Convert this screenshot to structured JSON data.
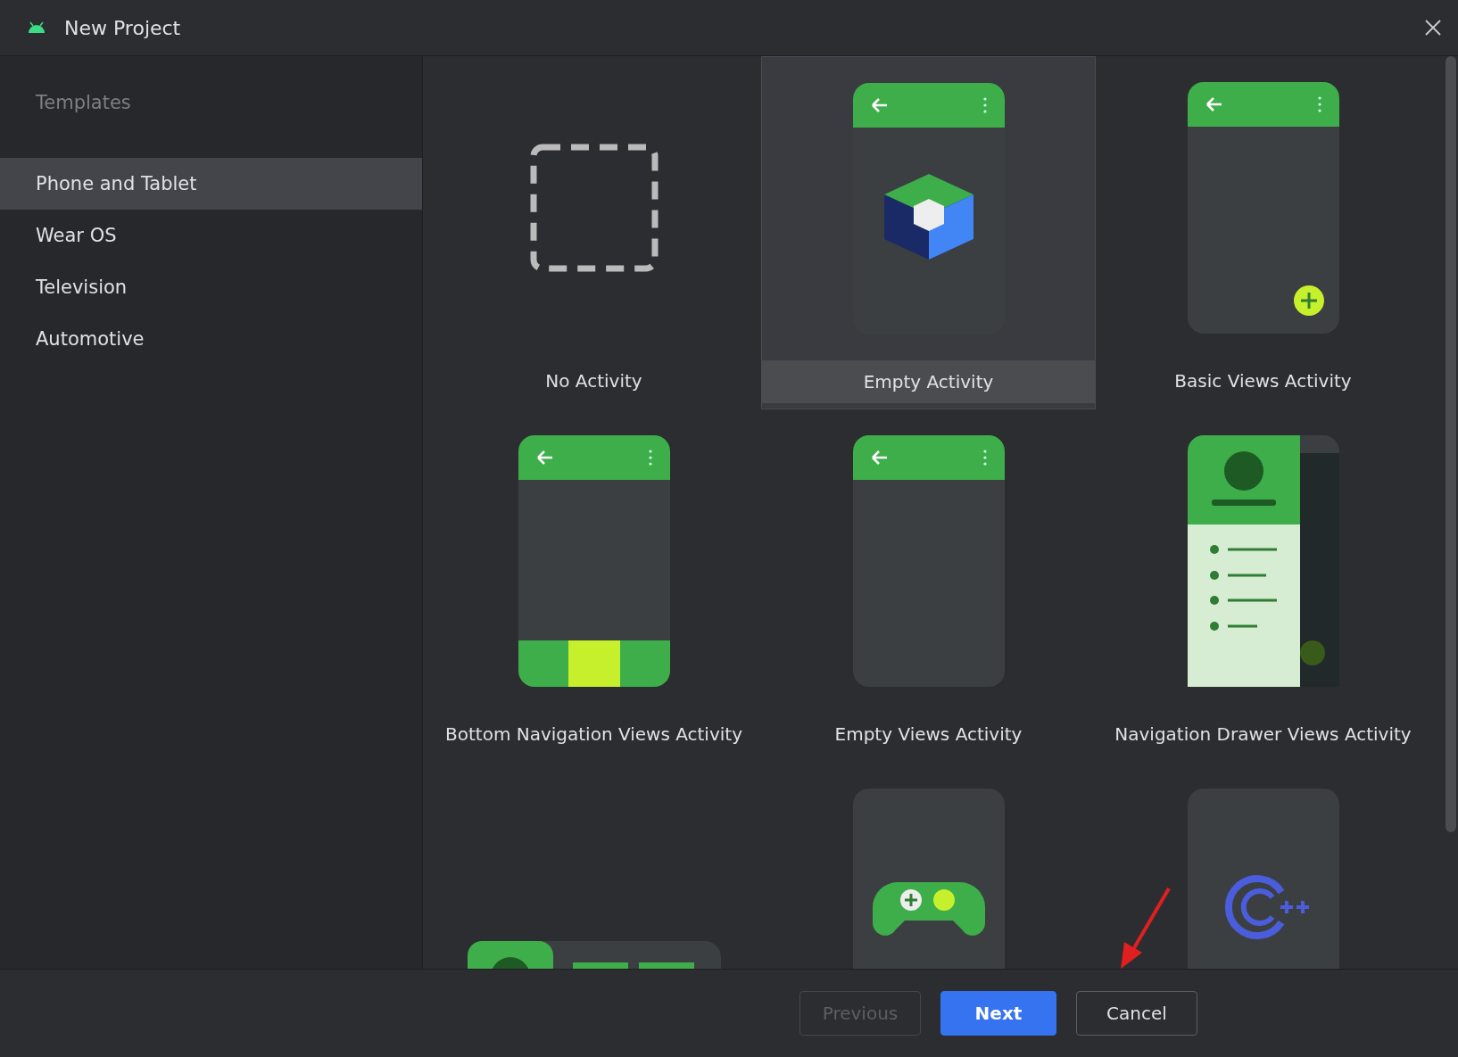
{
  "window": {
    "title": "New Project"
  },
  "sidebar": {
    "header": "Templates",
    "items": [
      {
        "label": "Phone and Tablet",
        "selected": true
      },
      {
        "label": "Wear OS",
        "selected": false
      },
      {
        "label": "Television",
        "selected": false
      },
      {
        "label": "Automotive",
        "selected": false
      }
    ]
  },
  "templates": [
    {
      "kind": "none",
      "name": "No Activity",
      "selected": false
    },
    {
      "kind": "compose",
      "name": "Empty Activity",
      "selected": true
    },
    {
      "kind": "basic",
      "name": "Basic Views Activity",
      "selected": false
    },
    {
      "kind": "bottom-nav",
      "name": "Bottom Navigation Views Activity",
      "selected": false
    },
    {
      "kind": "empty-views",
      "name": "Empty Views Activity",
      "selected": false
    },
    {
      "kind": "nav-drawer",
      "name": "Navigation Drawer Views Activity",
      "selected": false
    },
    {
      "kind": "responsive",
      "selected": false
    },
    {
      "kind": "game",
      "selected": false
    },
    {
      "kind": "cpp",
      "selected": false
    }
  ],
  "buttons": [
    {
      "label": "Previous",
      "kind": "plain",
      "disabled": true
    },
    {
      "label": "Next",
      "kind": "primary",
      "disabled": false
    },
    {
      "label": "Cancel",
      "kind": "plain",
      "disabled": false
    }
  ]
}
